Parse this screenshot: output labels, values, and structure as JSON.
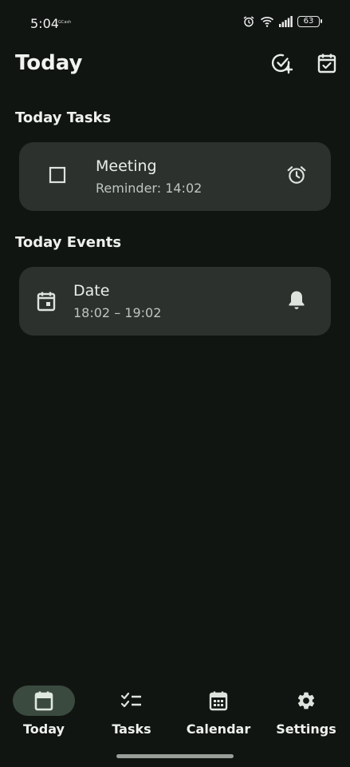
{
  "status_bar": {
    "time": "5:04",
    "carrier": "GCash",
    "battery": "63",
    "icons": [
      "alarm-icon",
      "wifi-icon",
      "signal-icon",
      "battery-icon"
    ]
  },
  "header": {
    "title": "Today",
    "actions": [
      {
        "name": "add-task-button",
        "icon": "check-circle-plus-icon"
      },
      {
        "name": "calendar-check-button",
        "icon": "calendar-check-icon"
      }
    ]
  },
  "tasks_section": {
    "title": "Today Tasks",
    "items": [
      {
        "title": "Meeting",
        "subtitle": "Reminder: 14:02",
        "checked": false,
        "trailing_icon": "alarm-icon"
      }
    ]
  },
  "events_section": {
    "title": "Today Events",
    "items": [
      {
        "title": "Date",
        "time_range": "18:02 – 19:02",
        "leading_icon": "calendar-event-icon",
        "trailing_icon": "bell-icon"
      }
    ]
  },
  "bottom_nav": {
    "items": [
      {
        "label": "Today",
        "icon": "calendar-today-icon",
        "active": true
      },
      {
        "label": "Tasks",
        "icon": "checklist-icon",
        "active": false
      },
      {
        "label": "Calendar",
        "icon": "calendar-month-icon",
        "active": false
      },
      {
        "label": "Settings",
        "icon": "gear-icon",
        "active": false
      }
    ]
  },
  "colors": {
    "background": "#111512",
    "card": "#2c312d",
    "active_pill": "#3a4a3e",
    "text": "#eef1ed"
  }
}
